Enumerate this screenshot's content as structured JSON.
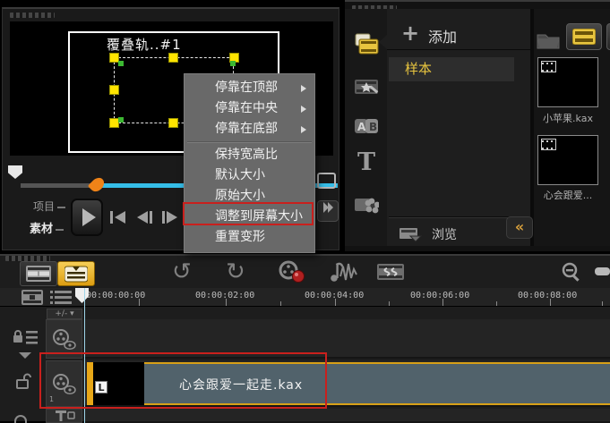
{
  "preview": {
    "overlay_label": "覆叠轨..#1",
    "project_label": "项目",
    "source_label": "素材"
  },
  "context_menu": {
    "items": [
      {
        "label": "停靠在顶部",
        "has_submenu": true
      },
      {
        "label": "停靠在中央",
        "has_submenu": true
      },
      {
        "label": "停靠在底部",
        "has_submenu": true
      },
      {
        "label": "保持宽高比",
        "has_submenu": false
      },
      {
        "label": "默认大小",
        "has_submenu": false
      },
      {
        "label": "原始大小",
        "has_submenu": false
      },
      {
        "label": "调整到屏幕大小",
        "has_submenu": false,
        "highlighted_red_box": true
      },
      {
        "label": "重置变形",
        "has_submenu": false
      }
    ]
  },
  "library": {
    "add_label": "添加",
    "sample_label": "样本",
    "browse_label": "浏览",
    "thumbnails": [
      {
        "name": "小苹果.kax"
      },
      {
        "name": "心会跟爱..."
      }
    ]
  },
  "timeline": {
    "ruler": [
      "00:00:00:00",
      "00:00:02:00",
      "00:00:04:00",
      "00:00:06:00",
      "00:00:08:00"
    ],
    "track_add_label": "+/-",
    "overlay_track_number": "1",
    "clip_name": "心会跟爱一起走.kax"
  },
  "icons": {
    "undo": "↺",
    "redo": "↻",
    "plus": "+",
    "collapse": "«",
    "clip_flag": "L",
    "ab_a": "A",
    "ab_b": "B",
    "title_t": "T"
  },
  "colors": {
    "accent_yellow": "#e8b73a",
    "highlight_red": "#c9201d",
    "scrub_cyan": "#35bde8",
    "marker_orange": "#ef8318",
    "clip_body": "#51626b",
    "handle_yellow": "#ffe400",
    "handle_green": "#3cb832"
  }
}
